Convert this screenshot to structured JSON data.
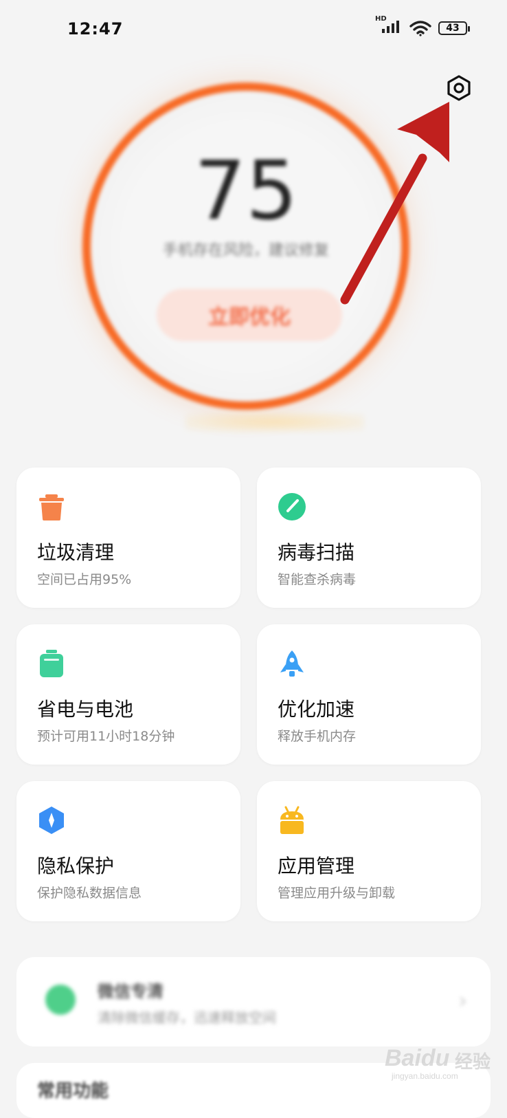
{
  "status": {
    "time": "12:47",
    "hd": "HD",
    "battery": "43"
  },
  "score": {
    "value": "75",
    "message": "手机存在风险，建议修复",
    "button": "立即优化"
  },
  "cards": [
    {
      "title": "垃圾清理",
      "subtitle": "空间已占用95%",
      "icon": "trash-icon",
      "color": "#f5834a"
    },
    {
      "title": "病毒扫描",
      "subtitle": "智能查杀病毒",
      "icon": "virus-scan-icon",
      "color": "#2ecc8f"
    },
    {
      "title": "省电与电池",
      "subtitle": "预计可用11小时18分钟",
      "icon": "battery-icon",
      "color": "#3fd09a"
    },
    {
      "title": "优化加速",
      "subtitle": "释放手机内存",
      "icon": "rocket-icon",
      "color": "#3aa0f5"
    },
    {
      "title": "隐私保护",
      "subtitle": "保护隐私数据信息",
      "icon": "privacy-shield-icon",
      "color": "#3a8ff5"
    },
    {
      "title": "应用管理",
      "subtitle": "管理应用升级与卸载",
      "icon": "android-icon",
      "color": "#f8b820"
    }
  ],
  "wechat": {
    "title": "微信专清",
    "subtitle": "清除微信缓存，迅速释放空间"
  },
  "bottom": {
    "title": "常用功能"
  },
  "watermark": {
    "brand": "Baidu",
    "cn": "经验",
    "url": "jingyan.baidu.com"
  },
  "colors": {
    "accent": "#f76a25",
    "arrow": "#c0201e"
  }
}
